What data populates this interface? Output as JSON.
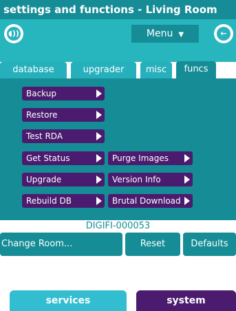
{
  "title": "settings and functions - Living Room",
  "toolbar": {
    "menu_label": "Menu",
    "speaker_icon": "speaker-icon",
    "back_icon": "back-arrow-icon"
  },
  "tabs": [
    {
      "label": "database",
      "active": false
    },
    {
      "label": "upgrader",
      "active": false
    },
    {
      "label": "misc",
      "active": false
    },
    {
      "label": "funcs",
      "active": true
    }
  ],
  "funcs": {
    "left": [
      "Backup",
      "Restore",
      "Test RDA",
      "Get Status",
      "Upgrade",
      "Rebuild DB"
    ],
    "right": [
      "Purge Images",
      "Version Info",
      "Brutal Download"
    ]
  },
  "device_id": "DIGIFI-000053",
  "actions": {
    "change_room": "Change Room...",
    "reset": "Reset",
    "defaults": "Defaults"
  },
  "bottom_tabs": [
    {
      "label": "services",
      "active": false
    },
    {
      "label": "system",
      "active": true
    }
  ],
  "colors": {
    "teal_dark": "#168d96",
    "teal_light": "#27b5be",
    "purple": "#4a1b6e"
  }
}
